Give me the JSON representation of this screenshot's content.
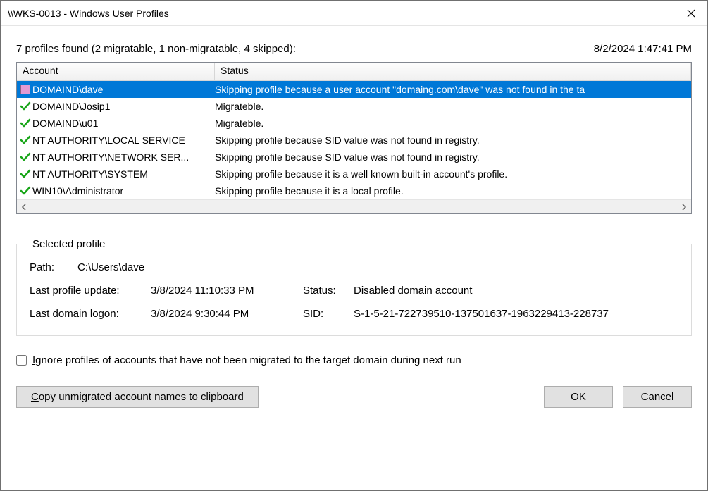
{
  "window": {
    "title": "\\\\WKS-0013 - Windows User Profiles"
  },
  "summary": {
    "text": "7 profiles found (2 migratable, 1 non-migratable, 4 skipped):",
    "timestamp": "8/2/2024 1:47:41 PM"
  },
  "columns": {
    "account": "Account",
    "status": "Status"
  },
  "rows": [
    {
      "icon": "pink",
      "account": "DOMAIND\\dave",
      "status": "Skipping profile because a user account \"domaing.com\\dave\" was not found in the ta",
      "selected": true
    },
    {
      "icon": "check",
      "account": "DOMAIND\\Josip1",
      "status": "Migrateble.",
      "selected": false
    },
    {
      "icon": "check",
      "account": "DOMAIND\\u01",
      "status": "Migrateble.",
      "selected": false
    },
    {
      "icon": "check",
      "account": "NT AUTHORITY\\LOCAL SERVICE",
      "status": "Skipping profile because SID value was not found in registry.",
      "selected": false
    },
    {
      "icon": "check",
      "account": "NT AUTHORITY\\NETWORK SER...",
      "status": "Skipping profile because SID value was not found in registry.",
      "selected": false
    },
    {
      "icon": "check",
      "account": "NT AUTHORITY\\SYSTEM",
      "status": "Skipping profile because it is a well known built-in account's profile.",
      "selected": false
    },
    {
      "icon": "check",
      "account": "WIN10\\Administrator",
      "status": "Skipping profile because it is a local profile.",
      "selected": false
    }
  ],
  "selected_profile": {
    "legend": "Selected profile",
    "path_label": "Path:",
    "path": "C:\\Users\\dave",
    "last_update_label": "Last profile update:",
    "last_update": "3/8/2024 11:10:33 PM",
    "status_label": "Status:",
    "status": "Disabled domain account",
    "last_logon_label": "Last domain logon:",
    "last_logon": "3/8/2024 9:30:44 PM",
    "sid_label": "SID:",
    "sid": "S-1-5-21-722739510-137501637-1963229413-228737"
  },
  "checkbox": {
    "label_pre": "I",
    "label_rest": "gnore profiles of accounts that have not been migrated to the target domain during next run",
    "checked": false
  },
  "buttons": {
    "copy_pre": "C",
    "copy_rest": "opy unmigrated account names to clipboard",
    "ok": "OK",
    "cancel": "Cancel"
  }
}
